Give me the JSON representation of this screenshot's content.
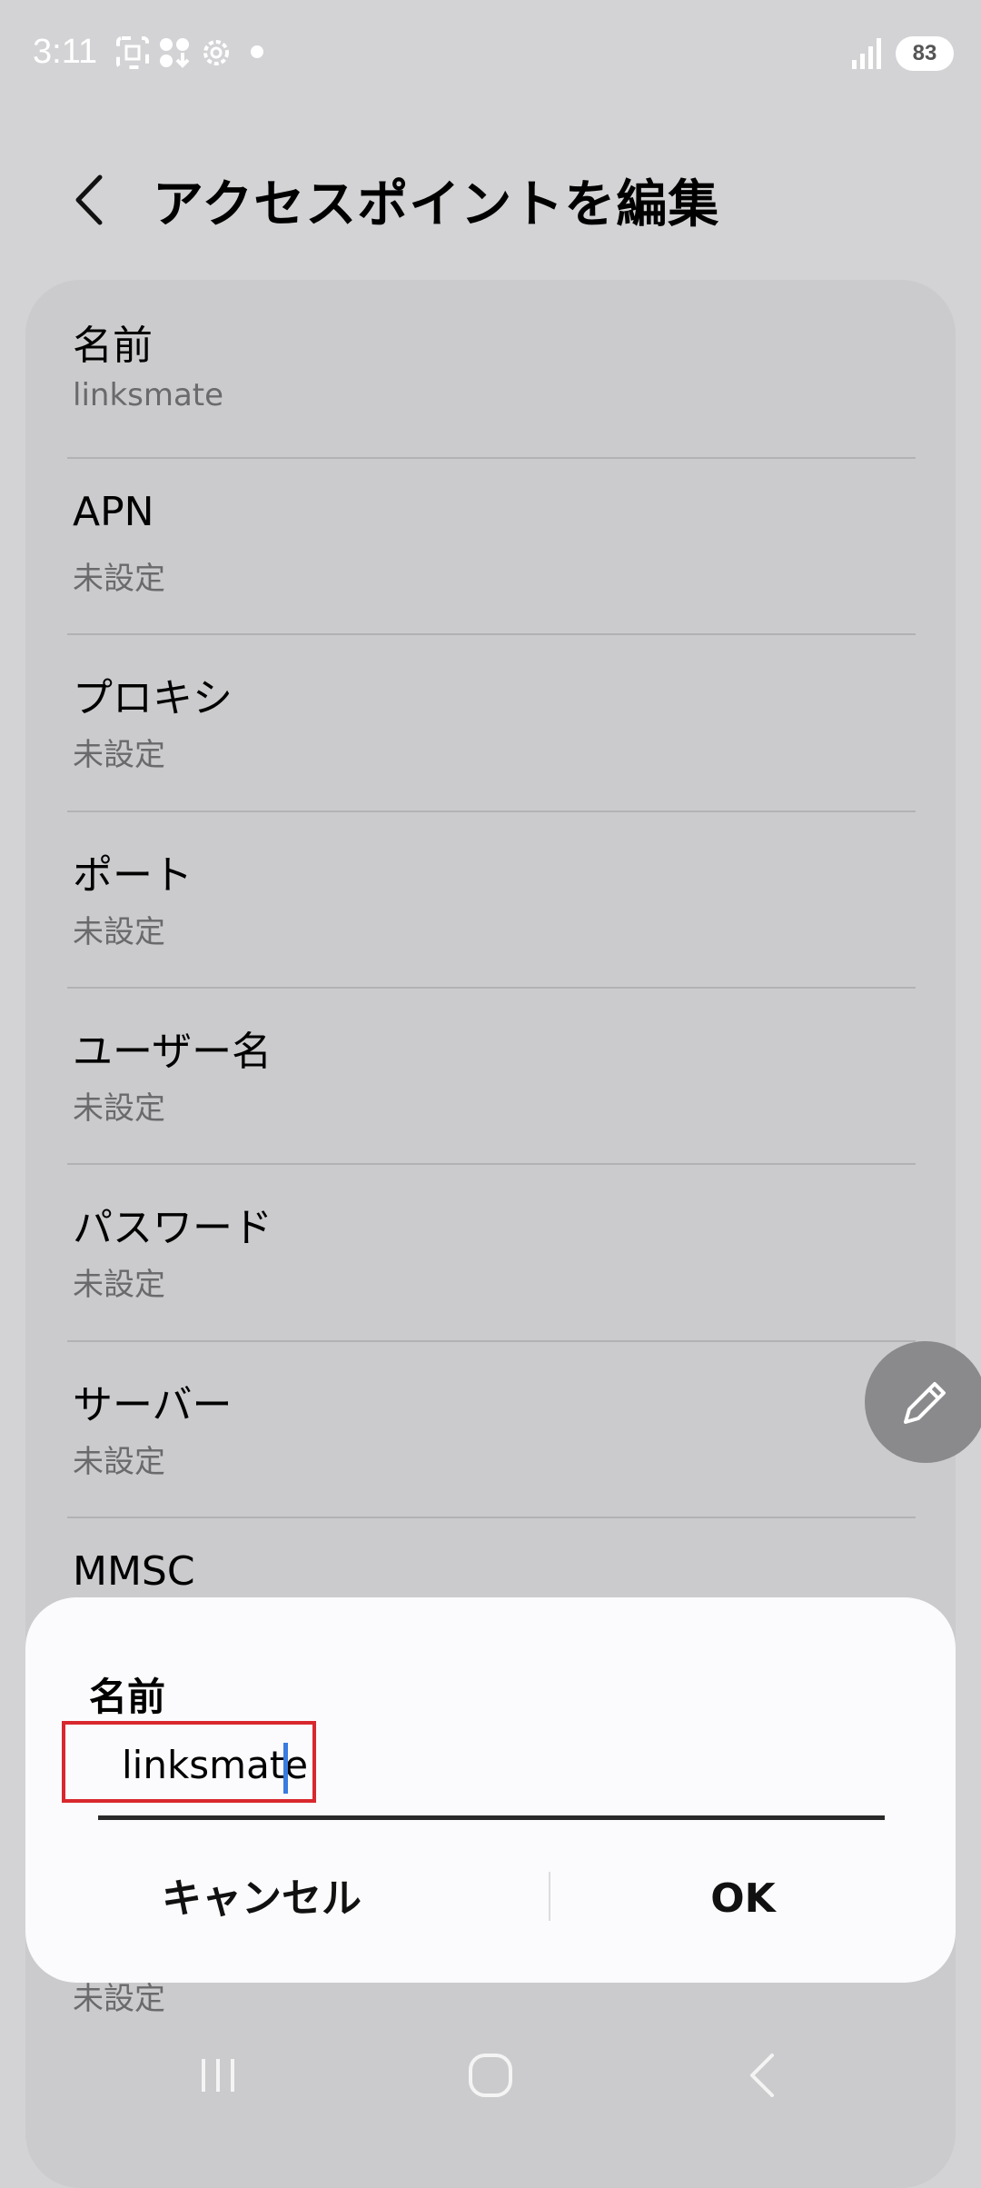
{
  "status_bar": {
    "time": "3:11",
    "battery": "83",
    "icons": [
      "screenshot-icon",
      "apps-icon",
      "settings-icon",
      "notification-dot-icon",
      "signal-icon",
      "battery-icon"
    ]
  },
  "header": {
    "title": "アクセスポイントを編集",
    "back_icon": "chevron-left-icon"
  },
  "settings": {
    "items": [
      {
        "label": "名前",
        "value": "linksmate"
      },
      {
        "label": "APN",
        "value": "未設定"
      },
      {
        "label": "プロキシ",
        "value": "未設定"
      },
      {
        "label": "ポート",
        "value": "未設定"
      },
      {
        "label": "ユーザー名",
        "value": "未設定"
      },
      {
        "label": "パスワード",
        "value": "未設定"
      },
      {
        "label": "サーバー",
        "value": "未設定"
      },
      {
        "label": "MMSC",
        "value": ""
      }
    ],
    "partial_value_below_dialog": "未設定"
  },
  "fab": {
    "icon": "pencil-icon"
  },
  "dialog": {
    "title": "名前",
    "input_value": "linksmate",
    "cancel_label": "キャンセル",
    "ok_label": "OK"
  },
  "nav_bar": {
    "icons": [
      "recents-icon",
      "home-icon",
      "back-icon"
    ]
  },
  "colors": {
    "background": "#d3d3d5",
    "card": "#cbcbcd",
    "dialog": "#fbfbfd",
    "highlight": "#d8282e",
    "cursor": "#3a7be0"
  }
}
